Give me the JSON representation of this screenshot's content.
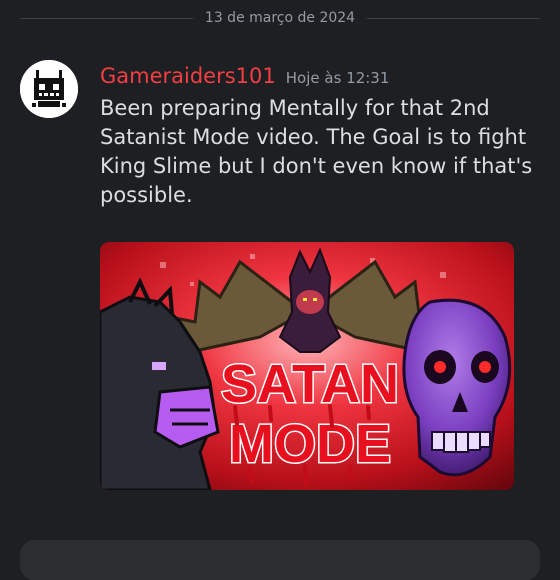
{
  "divider": {
    "date": "13 de março de 2024"
  },
  "message": {
    "username": "Gameraiders101",
    "timestamp": "Hoje às 12:31",
    "content": "Been preparing Mentally for that 2nd Satanist Mode video. The Goal is to fight King Slime but I don't even know if that's possible.",
    "avatar_icon": "robot-avatar-icon",
    "attachment": {
      "overlay_line1": "SATAN",
      "overlay_line2": "MODE"
    }
  },
  "colors": {
    "background": "#1e1f22",
    "username": "#f23f43",
    "text": "#dbdee1",
    "muted": "#949ba4",
    "composer": "#2b2d31"
  }
}
